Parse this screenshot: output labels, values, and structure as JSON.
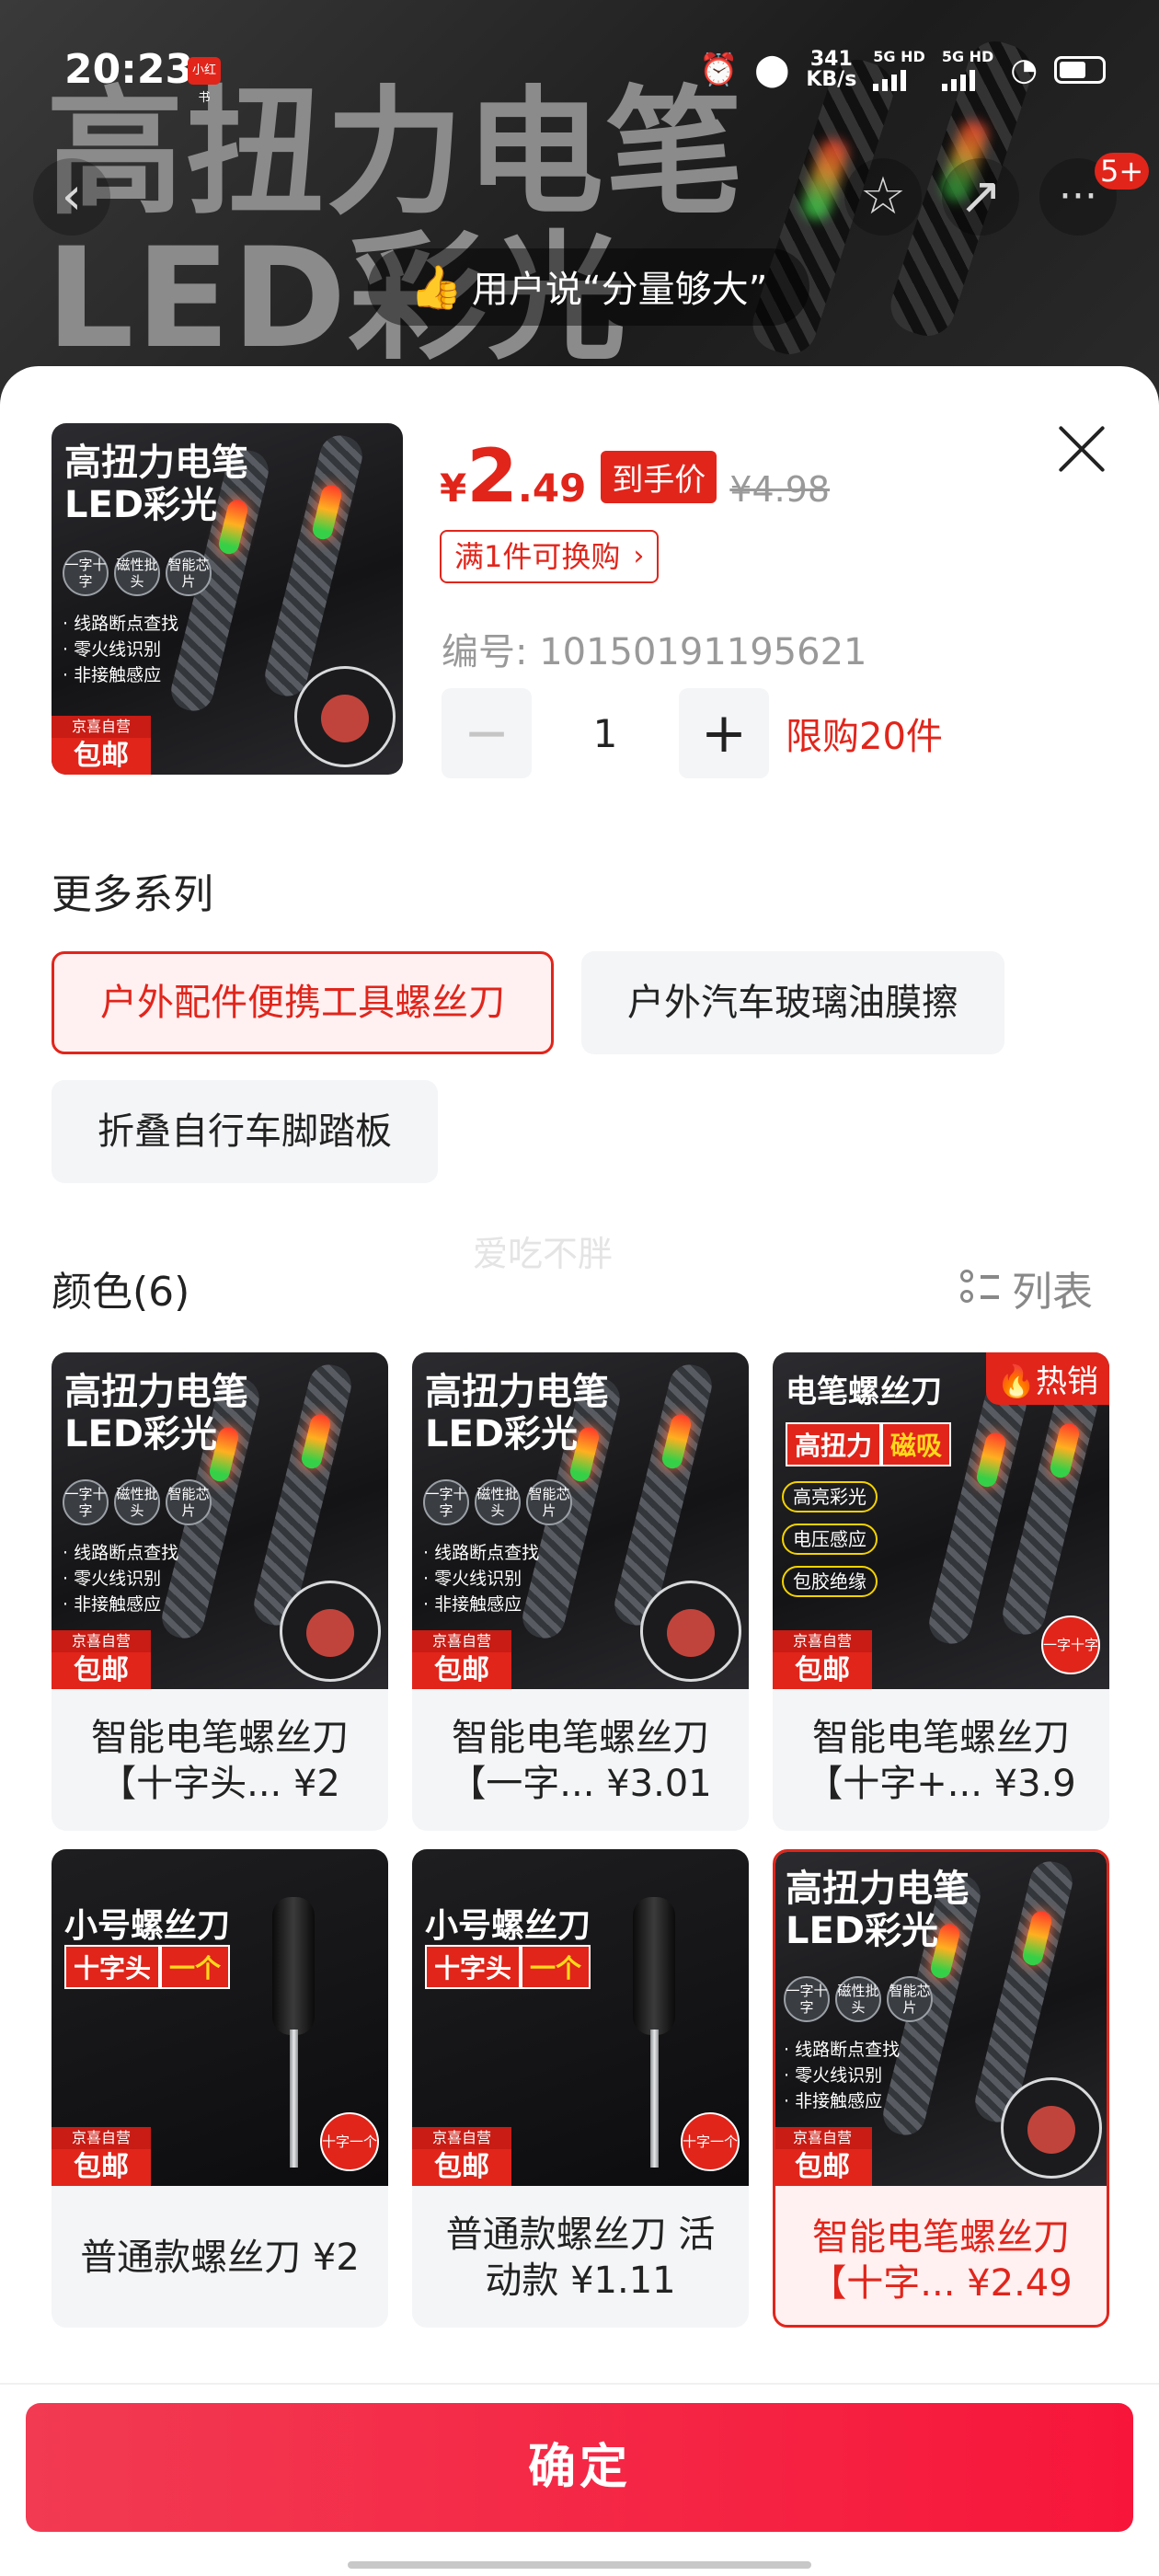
{
  "status_bar": {
    "time": "20:23",
    "app_badge": "小红书",
    "net_speed_value": "341",
    "net_speed_unit": "KB/s",
    "sim1": "5G HD",
    "sim2": "5G HD"
  },
  "backdrop": {
    "title_line1": "高扭力电笔",
    "title_line2": "LED彩光",
    "user_says": "用户说“分量够大”",
    "badge_count": "5+",
    "back_icon": "‹"
  },
  "product": {
    "price_symbol": "¥",
    "price_integer": "2",
    "price_decimal": ".49",
    "price_tag": "到手价",
    "original_price": "¥4.98",
    "promo": "满1件可换购",
    "sku_label": "编号: 10150191195621",
    "quantity": "1",
    "limit": "限购20件"
  },
  "image_text": {
    "title1": "高扭力电笔",
    "title2": "LED彩光",
    "feat1": "一字十字",
    "feat2": "磁性批头",
    "feat3": "智能芯片",
    "bullet1": "· 线路断点查找",
    "bullet2": "· 零火线识别",
    "bullet3": "· 非接触感应",
    "free_top": "京喜自营",
    "free_main": "包邮",
    "card3_title": "电笔螺丝刀",
    "card3_red": "高扭力",
    "card3_yellow": "磁吸",
    "card3_chip1": "高亮彩光",
    "card3_chip2": "电压感应",
    "card3_chip3": "包胶绝缘",
    "card3_round": "一字十字",
    "small_title": "小号螺丝刀",
    "small_red": "十字头",
    "small_yellow": "一个",
    "small_round": "十字一个"
  },
  "series": {
    "title": "更多系列",
    "items": [
      "户外配件便携工具螺丝刀",
      "户外汽车玻璃油膜擦",
      "折叠自行车脚踏板"
    ],
    "selected_index": 0
  },
  "colors": {
    "title": "颜色(6)",
    "list_toggle": "列表",
    "watermark": "爱吃不胖",
    "hot_badge": "热销",
    "items": [
      {
        "label": "智能电笔螺丝刀【十字头... ¥2"
      },
      {
        "label": "智能电笔螺丝刀【一字... ¥3.01"
      },
      {
        "label": "智能电笔螺丝刀【十字+... ¥3.9"
      },
      {
        "label": "普通款螺丝刀 ¥2"
      },
      {
        "label": "普通款螺丝刀 活动款 ¥1.11"
      },
      {
        "label": "智能电笔螺丝刀【十字... ¥2.49"
      }
    ],
    "selected_index": 5
  },
  "footer": {
    "confirm": "确定"
  },
  "theme": {
    "accent": "#e1251b",
    "button_gradient_start": "#f23a52",
    "button_gradient_end": "#f7163a"
  },
  "icons": [
    "back-icon",
    "star-icon",
    "share-icon",
    "more-icon",
    "close-icon",
    "thumbs-up-icon",
    "list-view-icon",
    "fire-icon",
    "chevron-right-icon",
    "minus-icon",
    "plus-icon"
  ]
}
